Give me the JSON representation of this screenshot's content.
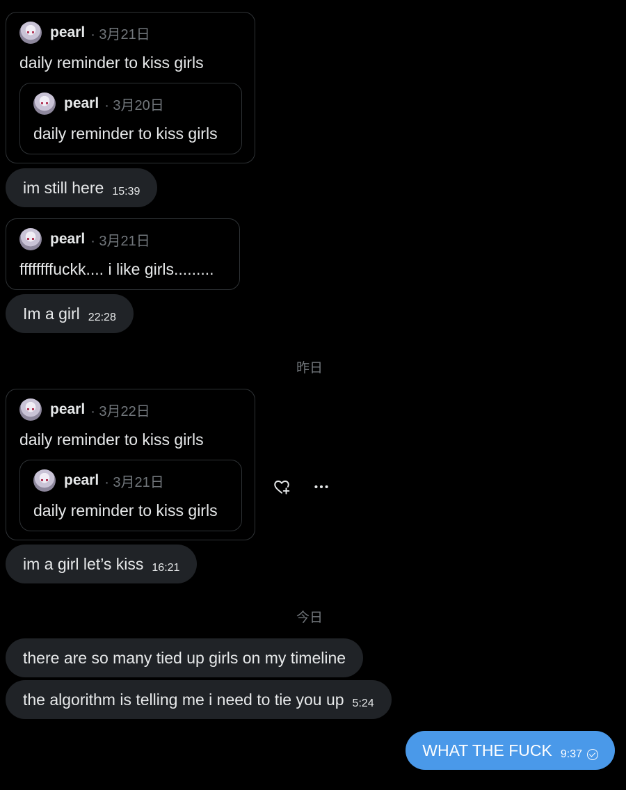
{
  "messages": [
    {
      "quote": {
        "author": "pearl",
        "date": "· 3月21日",
        "text": "daily reminder to kiss girls",
        "nested": {
          "author": "pearl",
          "date": "· 3月20日",
          "text": "daily reminder to kiss girls"
        }
      },
      "text": "im still here",
      "time": "15:39"
    },
    {
      "quote": {
        "author": "pearl",
        "date": "· 3月21日",
        "text": "ffffffffuckk.... i like girls........."
      },
      "text": "Im a girl",
      "time": "22:28"
    },
    {
      "separator": "昨日",
      "quote": {
        "author": "pearl",
        "date": "· 3月22日",
        "text": "daily reminder to kiss girls",
        "nested": {
          "author": "pearl",
          "date": "· 3月21日",
          "text": "daily reminder to kiss girls"
        }
      },
      "text": "im a girl let’s kiss",
      "time": "16:21"
    },
    {
      "separator": "今日",
      "lines": [
        {
          "text": "there are so many tied up girls on my timeline"
        },
        {
          "text": "the algorithm is telling me i need to tie you up",
          "time": "5:24"
        }
      ]
    }
  ],
  "sent": {
    "text": "WHAT THE FUCK",
    "time": "9:37"
  },
  "actions": {
    "icons": [
      "heart-plus-icon",
      "more-icon"
    ]
  },
  "colors": {
    "background": "#000000",
    "bubble": "#202327",
    "sent_bubble": "#4a99e9",
    "muted": "#71767b"
  }
}
